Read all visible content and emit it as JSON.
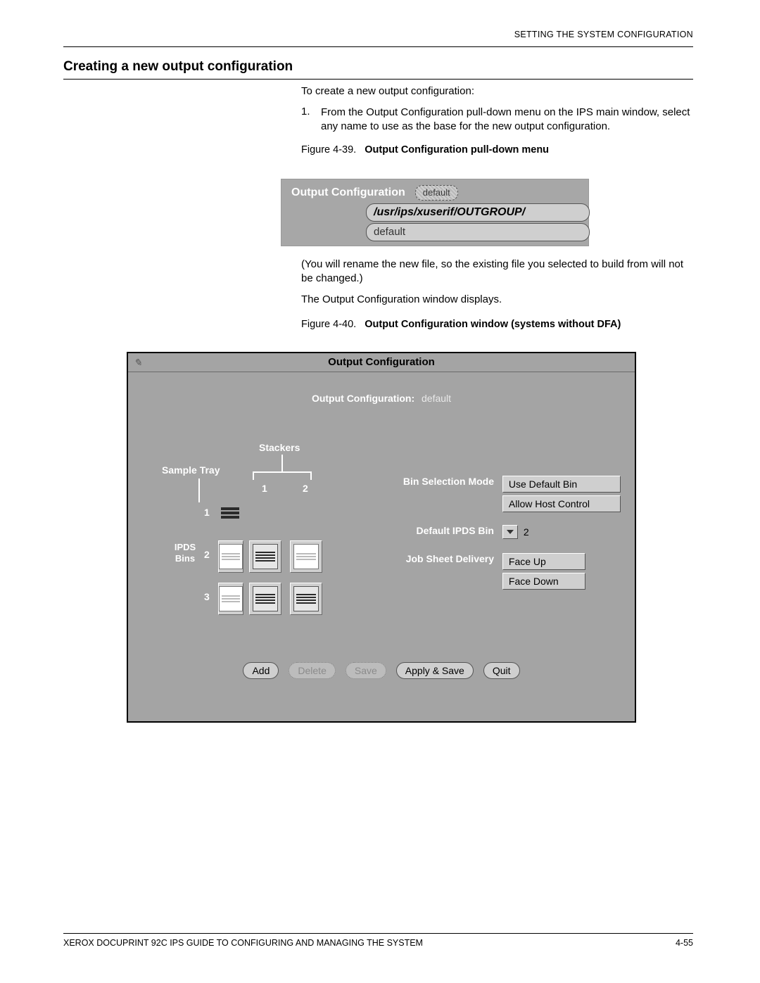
{
  "doc": {
    "running_header": "SETTING THE SYSTEM CONFIGURATION",
    "section_heading": "Creating a new output configuration",
    "intro": "To create a new output configuration:",
    "step1_num": "1.",
    "step1": "From the Output Configuration pull-down menu on the IPS main window, select any name to use as the base for the new output configuration.",
    "fig39_caption_label": "Figure 4-39.",
    "fig39_caption_title": "Output Configuration pull-down menu",
    "note_paren": "(You will rename the new file, so the existing file you selected to build from will not be changed.)",
    "note_after": "The Output Configuration window displays.",
    "fig40_caption_label": "Figure 4-40.",
    "fig40_caption_title": "Output Configuration window (systems without DFA)",
    "footer_text": "XEROX DOCUPRINT 92C IPS GUIDE TO CONFIGURING AND MANAGING THE SYSTEM",
    "footer_page": "4-55"
  },
  "fig39": {
    "title": "Output Configuration",
    "selected": "default",
    "path": "/usr/ips/xuserif/OUTGROUP/",
    "option": "default"
  },
  "fig40": {
    "title": "Output Configuration",
    "config_label": "Output Configuration:",
    "config_value": "default",
    "stackers_label": "Stackers",
    "sample_tray_label": "Sample Tray",
    "col1": "1",
    "col2": "2",
    "ipds_bins_label": "IPDS Bins",
    "row1": "1",
    "row2": "2",
    "row3": "3",
    "bin_selection_label": "Bin Selection Mode",
    "bin_selection_opts": [
      "Use Default Bin",
      "Allow Host Control"
    ],
    "default_ipds_bin_label": "Default IPDS Bin",
    "default_ipds_bin_value": "2",
    "job_sheet_label": "Job Sheet Delivery",
    "job_sheet_opts": [
      "Face Up",
      "Face Down"
    ],
    "buttons": {
      "add": "Add",
      "delete": "Delete",
      "save": "Save",
      "apply_save": "Apply & Save",
      "quit": "Quit"
    }
  }
}
